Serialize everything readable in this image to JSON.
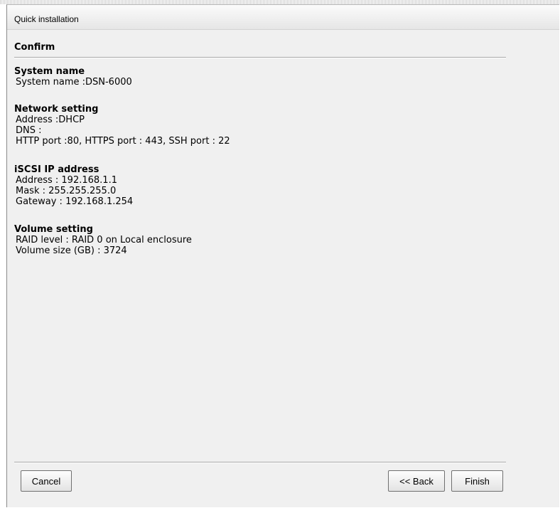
{
  "window": {
    "title": "Quick installation"
  },
  "confirm": {
    "heading": "Confirm"
  },
  "system": {
    "title": "System name",
    "lines": [
      "System name :DSN-6000"
    ]
  },
  "network": {
    "title": "Network setting",
    "lines": [
      "Address :DHCP",
      "DNS :",
      "HTTP port :80, HTTPS port : 443, SSH port : 22"
    ]
  },
  "iscsi": {
    "title": "iSCSI IP address",
    "lines": [
      "Address : 192.168.1.1",
      "Mask : 255.255.255.0",
      "Gateway : 192.168.1.254"
    ]
  },
  "volume": {
    "title": "Volume setting",
    "lines": [
      "RAID level : RAID 0 on Local enclosure",
      "Volume size (GB) : 3724"
    ]
  },
  "buttons": {
    "cancel": "Cancel",
    "back": "<< Back",
    "finish": "Finish"
  }
}
